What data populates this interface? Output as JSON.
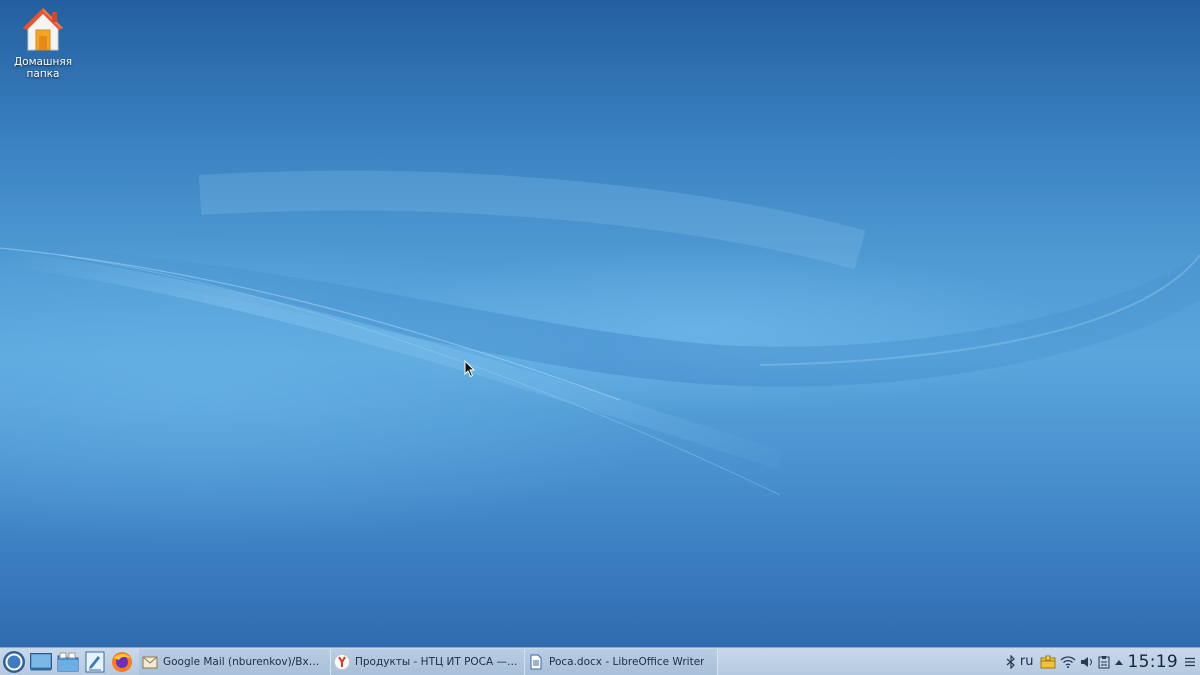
{
  "desktop": {
    "icons": [
      {
        "label": "Домашняя папка",
        "icon": "home-folder-icon"
      }
    ]
  },
  "taskbar": {
    "start_icon": "start-menu-icon",
    "launchers": [
      {
        "icon": "show-desktop-icon"
      },
      {
        "icon": "file-manager-icon"
      },
      {
        "icon": "text-editor-icon"
      },
      {
        "icon": "firefox-icon"
      }
    ],
    "tasks": [
      {
        "label": "Google Mail (nburenkov)/Входящие...",
        "icon": "mail-icon"
      },
      {
        "label": "Продукты - НТЦ ИТ РОСА — Яндек...",
        "icon": "yandex-browser-icon"
      },
      {
        "label": "Poca.docx - LibreOffice Writer",
        "icon": "writer-document-icon"
      }
    ],
    "tray": {
      "bluetooth_icon": "bluetooth-icon",
      "language": "ru",
      "network_icon": "wifi-icon",
      "volume_icon": "volume-icon",
      "clipboard_icon": "clipboard-icon",
      "expand_icon": "chevron-up-icon",
      "clock": "15:19",
      "menu_icon": "hamburger-menu-icon"
    }
  },
  "colors": {
    "desktop_top": "#245f9f",
    "desktop_mid": "#5aa6dc",
    "taskbar": "#c9d9ec",
    "task_button": "#b9cde3"
  }
}
